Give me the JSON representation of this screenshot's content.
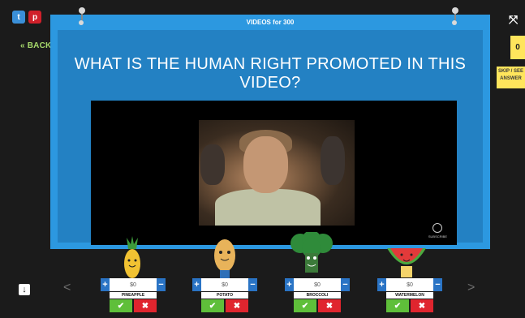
{
  "social": {
    "twitter_glyph": "t",
    "pinterest_glyph": "p"
  },
  "nav": {
    "back_label": "BACK",
    "prev_glyph": "<",
    "next_glyph": ">"
  },
  "board": {
    "title": "VIDEOS for 300",
    "question": "WHAT IS THE HUMAN RIGHT PROMOTED IN THIS VIDEO?",
    "video_watermark": "SUBSCRIBE"
  },
  "side": {
    "score": "0",
    "skip_label": "SKIP / SEE ANSWER"
  },
  "players": [
    {
      "name": "PINEAPPLE",
      "money": "$0",
      "color": "#f1c232"
    },
    {
      "name": "POTATO",
      "money": "$0",
      "color": "#e8b35a"
    },
    {
      "name": "BROCCOLI",
      "money": "$0",
      "color": "#2f8b3a"
    },
    {
      "name": "WATERMELON",
      "money": "$0",
      "color": "#e33a3a"
    }
  ],
  "icons": [
    "twitter-icon",
    "pinterest-icon",
    "expand-icon",
    "download-icon",
    "plus-icon",
    "minus-icon",
    "check-icon",
    "cross-icon"
  ]
}
